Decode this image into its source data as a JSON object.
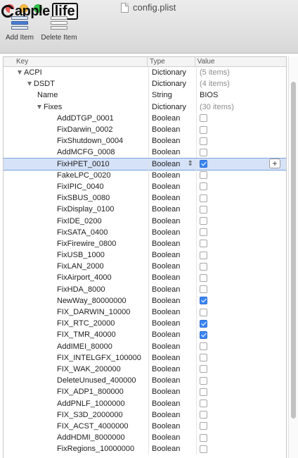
{
  "window": {
    "title": "config.plist",
    "logo": {
      "part1": "apple",
      "part2": "life"
    }
  },
  "toolbar": {
    "add_label": "Add Item",
    "delete_label": "Delete Item"
  },
  "columns": {
    "key": "Key",
    "type": "Type",
    "value": "Value"
  },
  "rows": [
    {
      "key": "ACPI",
      "indent": 1,
      "disclosure": true,
      "type": "Dictionary",
      "value": "(5 items)",
      "kind": "summary"
    },
    {
      "key": "DSDT",
      "indent": 2,
      "disclosure": true,
      "type": "Dictionary",
      "value": "(4 items)",
      "kind": "summary"
    },
    {
      "key": "Name",
      "indent": 3,
      "disclosure": false,
      "type": "String",
      "value": "BIOS",
      "kind": "text"
    },
    {
      "key": "Fixes",
      "indent": 3,
      "disclosure": true,
      "type": "Dictionary",
      "value": "(30 items)",
      "kind": "summary"
    },
    {
      "key": "AddDTGP_0001",
      "indent": 4,
      "type": "Boolean",
      "checked": false,
      "kind": "bool"
    },
    {
      "key": "FixDarwin_0002",
      "indent": 4,
      "type": "Boolean",
      "checked": false,
      "kind": "bool"
    },
    {
      "key": "FixShutdown_0004",
      "indent": 4,
      "type": "Boolean",
      "checked": false,
      "kind": "bool"
    },
    {
      "key": "AddMCFG_0008",
      "indent": 4,
      "type": "Boolean",
      "checked": false,
      "kind": "bool"
    },
    {
      "key": "FixHPET_0010",
      "indent": 4,
      "type": "Boolean",
      "checked": true,
      "kind": "bool",
      "selected": true
    },
    {
      "key": "FakeLPC_0020",
      "indent": 4,
      "type": "Boolean",
      "checked": false,
      "kind": "bool"
    },
    {
      "key": "FixIPIC_0040",
      "indent": 4,
      "type": "Boolean",
      "checked": false,
      "kind": "bool"
    },
    {
      "key": "FixSBUS_0080",
      "indent": 4,
      "type": "Boolean",
      "checked": false,
      "kind": "bool"
    },
    {
      "key": "FixDisplay_0100",
      "indent": 4,
      "type": "Boolean",
      "checked": false,
      "kind": "bool"
    },
    {
      "key": "FixIDE_0200",
      "indent": 4,
      "type": "Boolean",
      "checked": false,
      "kind": "bool"
    },
    {
      "key": "FixSATA_0400",
      "indent": 4,
      "type": "Boolean",
      "checked": false,
      "kind": "bool"
    },
    {
      "key": "FixFirewire_0800",
      "indent": 4,
      "type": "Boolean",
      "checked": false,
      "kind": "bool"
    },
    {
      "key": "FixUSB_1000",
      "indent": 4,
      "type": "Boolean",
      "checked": false,
      "kind": "bool"
    },
    {
      "key": "FixLAN_2000",
      "indent": 4,
      "type": "Boolean",
      "checked": false,
      "kind": "bool"
    },
    {
      "key": "FixAirport_4000",
      "indent": 4,
      "type": "Boolean",
      "checked": false,
      "kind": "bool"
    },
    {
      "key": "FixHDA_8000",
      "indent": 4,
      "type": "Boolean",
      "checked": false,
      "kind": "bool"
    },
    {
      "key": "NewWay_80000000",
      "indent": 4,
      "type": "Boolean",
      "checked": true,
      "kind": "bool"
    },
    {
      "key": "FIX_DARWIN_10000",
      "indent": 4,
      "type": "Boolean",
      "checked": false,
      "kind": "bool"
    },
    {
      "key": "FIX_RTC_20000",
      "indent": 4,
      "type": "Boolean",
      "checked": true,
      "kind": "bool"
    },
    {
      "key": "FIX_TMR_40000",
      "indent": 4,
      "type": "Boolean",
      "checked": true,
      "kind": "bool"
    },
    {
      "key": "AddIMEI_80000",
      "indent": 4,
      "type": "Boolean",
      "checked": false,
      "kind": "bool"
    },
    {
      "key": "FIX_INTELGFX_100000",
      "indent": 4,
      "type": "Boolean",
      "checked": false,
      "kind": "bool"
    },
    {
      "key": "FIX_WAK_200000",
      "indent": 4,
      "type": "Boolean",
      "checked": false,
      "kind": "bool"
    },
    {
      "key": "DeleteUnused_400000",
      "indent": 4,
      "type": "Boolean",
      "checked": false,
      "kind": "bool"
    },
    {
      "key": "FIX_ADP1_800000",
      "indent": 4,
      "type": "Boolean",
      "checked": false,
      "kind": "bool"
    },
    {
      "key": "AddPNLF_1000000",
      "indent": 4,
      "type": "Boolean",
      "checked": false,
      "kind": "bool"
    },
    {
      "key": "FIX_S3D_2000000",
      "indent": 4,
      "type": "Boolean",
      "checked": false,
      "kind": "bool"
    },
    {
      "key": "FIX_ACST_4000000",
      "indent": 4,
      "type": "Boolean",
      "checked": false,
      "kind": "bool"
    },
    {
      "key": "AddHDMI_8000000",
      "indent": 4,
      "type": "Boolean",
      "checked": false,
      "kind": "bool"
    },
    {
      "key": "FixRegions_10000000",
      "indent": 4,
      "type": "Boolean",
      "checked": false,
      "kind": "bool"
    }
  ],
  "icons": {
    "add": "add-item-icon",
    "delete": "delete-item-icon",
    "file": "document-icon",
    "plus": "plus-icon",
    "stepper": "up-down-stepper-icon"
  },
  "colors": {
    "selection": "#d5e2f7",
    "checkbox_on": "#3b86f6",
    "muted_text": "#8c8c8c"
  }
}
